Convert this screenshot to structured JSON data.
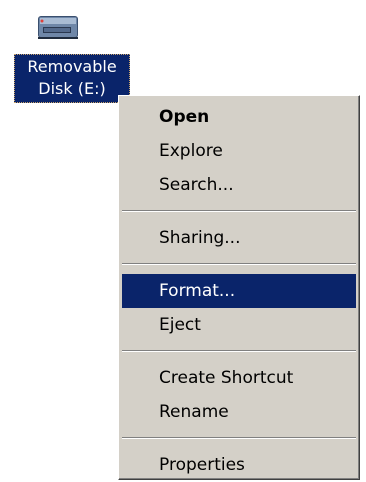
{
  "desktop_icon": {
    "label": "Removable\nDisk (E:)",
    "icon": "removable-drive-icon"
  },
  "context_menu": {
    "items": [
      {
        "label": "Open",
        "bold": true
      },
      {
        "label": "Explore"
      },
      {
        "label": "Search..."
      },
      {
        "label": "Sharing..."
      },
      {
        "label": "Format...",
        "highlighted": true
      },
      {
        "label": "Eject"
      },
      {
        "label": "Create Shortcut"
      },
      {
        "label": "Rename"
      },
      {
        "label": "Properties"
      }
    ]
  },
  "colors": {
    "selection": "#0a246a",
    "menu_background": "#d4d0c8"
  }
}
